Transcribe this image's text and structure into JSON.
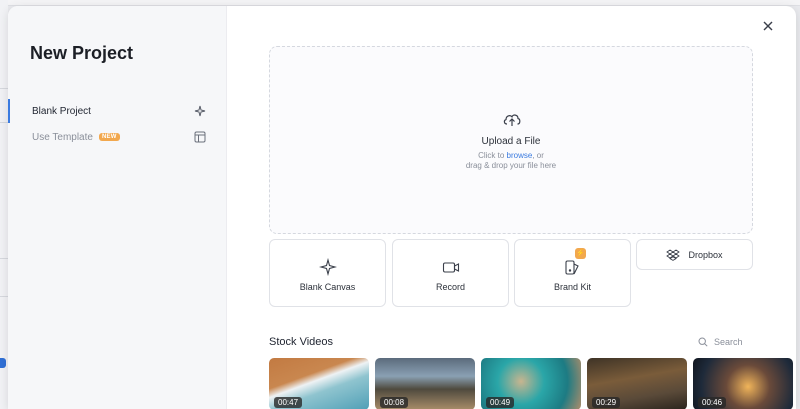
{
  "modal": {
    "title": "New Project",
    "nav": [
      {
        "label": "Blank Project",
        "icon": "sparkle-icon",
        "active": true
      },
      {
        "label": "Use Template",
        "badge": "NEW",
        "icon": "template-icon",
        "active": false
      }
    ],
    "close_icon": "close-icon"
  },
  "upload": {
    "title": "Upload a File",
    "line1_prefix": "Click to ",
    "line1_link": "browse",
    "line1_suffix": ", or",
    "line2": "drag & drop your file here",
    "icon": "cloud-upload-icon"
  },
  "tiles": [
    {
      "label": "Blank Canvas",
      "icon": "sparkle-icon"
    },
    {
      "label": "Record",
      "icon": "video-camera-icon"
    },
    {
      "label": "Brand Kit",
      "icon": "brand-kit-icon",
      "badge_icon": "lightning-icon"
    }
  ],
  "dropbox": {
    "label": "Dropbox",
    "icon": "dropbox-icon"
  },
  "stock": {
    "title": "Stock Videos",
    "search_placeholder": "Search",
    "videos": [
      {
        "duration": "00:47"
      },
      {
        "duration": "00:08"
      },
      {
        "duration": "00:49"
      },
      {
        "duration": "00:29"
      },
      {
        "duration": "00:46"
      }
    ]
  },
  "colors": {
    "accent": "#3b7be0",
    "badge": "#f2a84e",
    "sidebar_bg": "#f6f7f9"
  }
}
